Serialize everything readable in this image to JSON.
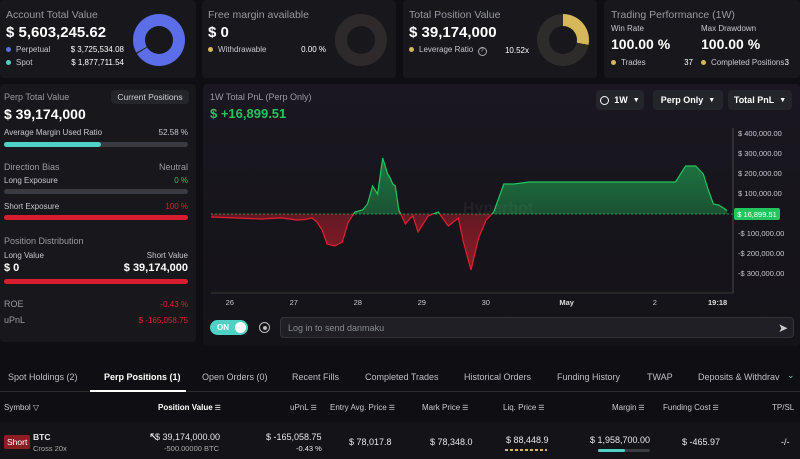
{
  "summary": {
    "account_total_value": {
      "label": "Account Total Value",
      "value": "$ 5,603,245.62",
      "perpetual_label": "Perpetual",
      "perpetual_value": "$ 3,725,534.08",
      "spot_label": "Spot",
      "spot_value": "$ 1,877,711.54"
    },
    "free_margin": {
      "label": "Free margin available",
      "value": "$ 0",
      "withdrawable_label": "Withdrawable",
      "withdrawable_value": "0.00 %"
    },
    "total_position_value": {
      "label": "Total Position Value",
      "value": "$ 39,174,000",
      "leverage_label": "Leverage Ratio",
      "leverage_value": "10.52x"
    },
    "trading_performance": {
      "label": "Trading Performance (1W)",
      "win_rate_label": "Win Rate",
      "win_rate_value": "100.00 %",
      "max_drawdown_label": "Max Drawdown",
      "max_drawdown_value": "100.00 %",
      "trades_label": "Trades",
      "trades_value": "37",
      "completed_label": "Completed Positions",
      "completed_value": "3"
    }
  },
  "left_panel": {
    "perp_total_label": "Perp Total Value",
    "perp_total_value": "$ 39,174,000",
    "current_positions_button": "Current Positions",
    "avg_margin_label": "Average Margin Used Ratio",
    "avg_margin_value": "52.58 %",
    "avg_margin_fraction": 0.5258,
    "direction_bias_label": "Direction Bias",
    "direction_bias_value": "Neutral",
    "long_exposure_label": "Long Exposure",
    "long_exposure_value": "0 %",
    "short_exposure_label": "Short Exposure",
    "short_exposure_value": "100 %",
    "position_distribution_label": "Position Distribution",
    "long_value_label": "Long Value",
    "short_value_label": "Short Value",
    "long_value": "$ 0",
    "short_value": "$ 39,174,000",
    "roe_label": "ROE",
    "roe_value": "-0.43 %",
    "upnl_label": "uPnL",
    "upnl_value": "$ -165,058.75"
  },
  "chart_panel": {
    "title": "1W Total PnL (Perp Only)",
    "value": "$ +16,899.51",
    "timeframe_button": "1W",
    "scope_button": "Perp Only",
    "metric_button": "Total PnL",
    "toggle_label": "ON",
    "danmaku_placeholder": "Log in to send danmaku",
    "watermark": "Hyperbot"
  },
  "chart_data": {
    "type": "area",
    "title": "1W Total PnL (Perp Only)",
    "x_ticks": [
      "26",
      "27",
      "28",
      "29",
      "30",
      "May",
      "2",
      "19:18"
    ],
    "y_ticks": [
      "$ 400,000.00",
      "$ 300,000.00",
      "$ 200,000.00",
      "$ 100,000.00",
      "$ 0.00",
      "-$ 100,000.00",
      "-$ 200,000.00",
      "-$ 300,000.00"
    ],
    "ylim": [
      -330000,
      420000
    ],
    "current_label": "$ 16,899.51",
    "x": [
      0,
      0.5,
      1.0,
      1.2,
      1.4,
      1.55,
      1.7,
      1.85,
      2.0,
      2.1,
      2.2,
      2.3,
      2.45,
      2.6,
      2.72,
      2.85,
      3.0,
      3.1,
      3.2,
      3.3,
      3.4,
      3.5,
      3.55,
      3.6,
      3.65,
      3.72,
      3.85,
      3.95,
      4.0,
      4.1,
      4.3,
      4.5,
      4.7,
      4.9,
      5.0,
      5.15,
      5.3,
      5.45,
      5.6,
      5.8,
      6.0,
      6.3,
      6.6,
      7.0,
      7.3,
      7.6,
      7.9,
      8.2,
      8.5,
      8.75,
      9.0,
      9.2,
      9.4,
      9.6,
      9.75,
      9.85,
      9.95,
      10.05,
      10.15,
      10.22
    ],
    "y": [
      -15000,
      -20000,
      -25000,
      -22000,
      -20000,
      -25000,
      -30000,
      -28000,
      -20000,
      -40000,
      -80000,
      -150000,
      -160000,
      -140000,
      -40000,
      10000,
      20000,
      50000,
      140000,
      100000,
      280000,
      200000,
      180000,
      150000,
      140000,
      20000,
      -50000,
      -20000,
      -10000,
      -90000,
      -10000,
      10000,
      -60000,
      -20000,
      -140000,
      -280000,
      -120000,
      -30000,
      10000,
      150000,
      150000,
      160000,
      160000,
      160000,
      160000,
      160000,
      160000,
      160000,
      160000,
      160000,
      160000,
      160000,
      240000,
      240000,
      200000,
      120000,
      50000,
      45000,
      30000,
      16900
    ]
  },
  "tabs": [
    "Spot Holdings (2)",
    "Perp Positions (1)",
    "Open Orders (0)",
    "Recent Fills",
    "Completed Trades",
    "Historical Orders",
    "Funding History",
    "TWAP",
    "Deposits & Withdrav"
  ],
  "table": {
    "headers": [
      "Symbol",
      "Position Value",
      "uPnL",
      "Entry Avg. Price",
      "Mark Price",
      "Liq. Price",
      "Margin",
      "Funding Cost",
      "TP/SL"
    ],
    "row": {
      "side": "Short",
      "symbol": "BTC",
      "sub": "Cross 20x",
      "position_value": "$ 39,174,000.00",
      "position_size": "-500.00000 BTC",
      "upnl": "$ -165,058.75",
      "upnl_pct": "-0.43 %",
      "entry_price": "$ 78,017.8",
      "mark_price": "$ 78,348.0",
      "liq_price": "$ 88,448.9",
      "margin": "$ 1,958,700.00",
      "funding_cost": "$ -465.97",
      "tpsl": "-/-"
    }
  },
  "colors": {
    "green": "#22c55e",
    "red": "#e02030",
    "teal": "#4fd1c5",
    "blue": "#5b6ee8",
    "gold": "#d6b85a"
  }
}
